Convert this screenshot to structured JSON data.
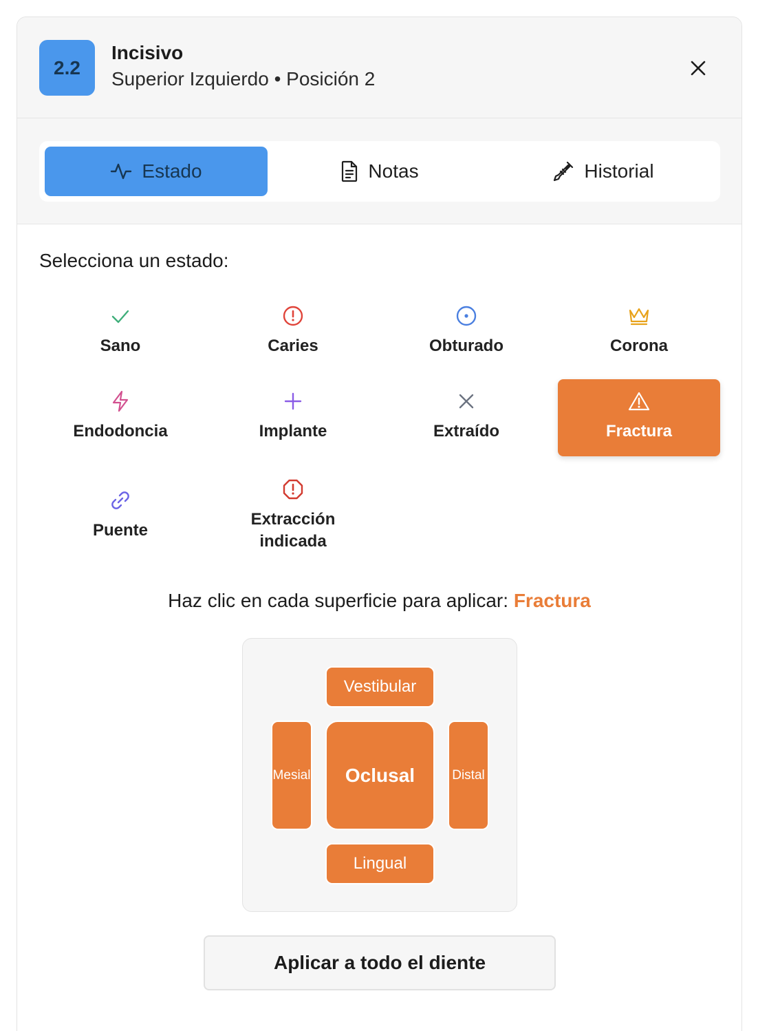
{
  "header": {
    "badge": "2.2",
    "title": "Incisivo",
    "subtitle": "Superior Izquierdo • Posición 2"
  },
  "tabs": [
    {
      "label": "Estado",
      "icon": "activity-icon",
      "active": true
    },
    {
      "label": "Notas",
      "icon": "document-icon",
      "active": false
    },
    {
      "label": "Historial",
      "icon": "syringe-icon",
      "active": false
    }
  ],
  "prompt": "Selecciona un estado:",
  "statuses": [
    {
      "label": "Sano",
      "icon": "check-icon",
      "color": "#3fae7a"
    },
    {
      "label": "Caries",
      "icon": "alert-circle-icon",
      "color": "#e0443a"
    },
    {
      "label": "Obturado",
      "icon": "target-circle-icon",
      "color": "#4a7fe0"
    },
    {
      "label": "Corona",
      "icon": "crown-icon",
      "color": "#e8a21a"
    },
    {
      "label": "Endodoncia",
      "icon": "lightning-icon",
      "color": "#d2508f"
    },
    {
      "label": "Implante",
      "icon": "plus-icon",
      "color": "#8a5ce6"
    },
    {
      "label": "Extraído",
      "icon": "x-icon",
      "color": "#6b7280"
    },
    {
      "label": "Fractura",
      "icon": "warning-triangle-icon",
      "color": "#ffffff",
      "selected": true
    },
    {
      "label": "Puente",
      "icon": "link-icon",
      "color": "#6b63e6"
    },
    {
      "label": "Extracción indicada",
      "icon": "alert-octagon-icon",
      "color": "#d23a2f"
    }
  ],
  "instruction": {
    "text": "Haz clic en cada superficie para aplicar:",
    "selected": "Fractura"
  },
  "surfaces": {
    "vestibular": "Vestibular",
    "mesial": "Mesial",
    "oclusal": "Oclusal",
    "distal": "Distal",
    "lingual": "Lingual"
  },
  "apply_label": "Aplicar a todo el diente",
  "colors": {
    "accent": "#4a97ec",
    "selected": "#e97d38"
  }
}
